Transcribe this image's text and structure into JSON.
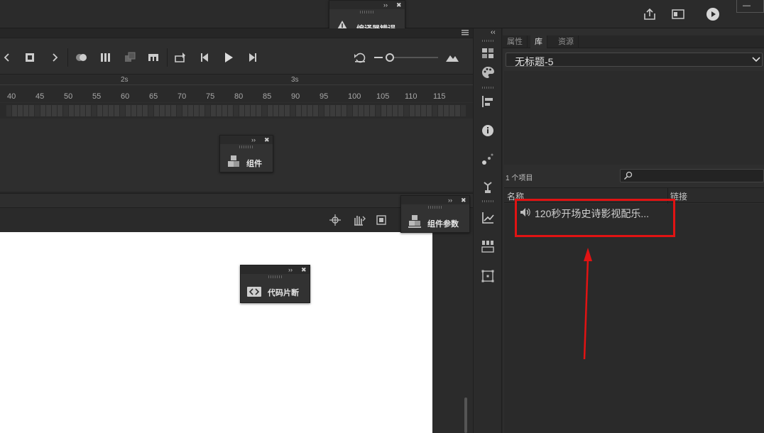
{
  "compiler_errors_panel": {
    "label": "编译器错误",
    "expand_glyph": "››",
    "close_glyph": "✖"
  },
  "components_panel": {
    "label": "组件",
    "expand_glyph": "››",
    "close_glyph": "✖"
  },
  "component_params_panel": {
    "label": "组件参数",
    "expand_glyph": "››",
    "close_glyph": "✖"
  },
  "code_snippets_panel": {
    "label": "代码片断",
    "expand_glyph": "››",
    "close_glyph": "✖"
  },
  "topbar": {
    "icons": [
      "share-icon",
      "screen-mode-icon",
      "test-movie-play-icon"
    ],
    "window_minimize_glyph": "—"
  },
  "timeline": {
    "time_markers": [
      "2s",
      "3s"
    ],
    "frame_ticks": [
      "40",
      "45",
      "50",
      "55",
      "60",
      "65",
      "70",
      "75",
      "80",
      "85",
      "90",
      "95",
      "100",
      "105",
      "110",
      "115"
    ],
    "toolbar_icons": [
      "previous-arrow-icon",
      "stop-icon",
      "next-arrow-icon",
      "onion-skin-icon",
      "edit-multiple-frames-icon",
      "paste-frames-icon",
      "insert-frame-icon",
      "loop-icon",
      "step-back-icon",
      "play-icon",
      "step-forward-icon",
      "undo-zoom-icon",
      "zoom-slider",
      "mountain-zoom-icon"
    ]
  },
  "dock": {
    "collapse_glyph": "‹‹",
    "icons": [
      "swatches-icon",
      "color-palette-icon",
      "align-icon",
      "info-icon",
      "motion-presets-icon",
      "transform-icon",
      "motion-editor-icon",
      "frame-picker-icon",
      "transform-grid-icon"
    ]
  },
  "library": {
    "tabs": [
      {
        "label": "属性",
        "active": false
      },
      {
        "label": "库",
        "active": true
      },
      {
        "label": "资源",
        "active": false
      }
    ],
    "document_name": "无标题-5",
    "item_count": "1 个项目",
    "search_placeholder": "",
    "columns": {
      "name": "名称",
      "linkage": "链接"
    },
    "items": [
      {
        "icon": "sound-icon",
        "name": "120秒开场史诗影视配乐..."
      }
    ]
  }
}
